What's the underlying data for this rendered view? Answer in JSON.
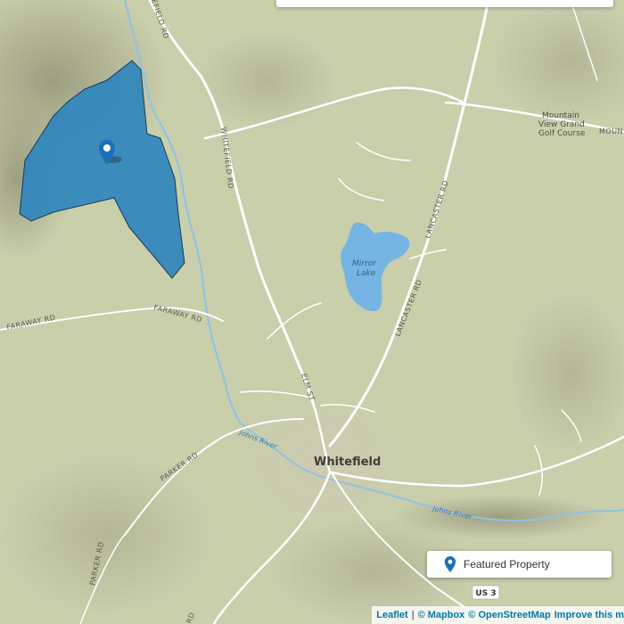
{
  "map": {
    "places": {
      "town": "Whitefield",
      "lake": [
        "Mirror",
        "Lake"
      ],
      "golf": [
        "Mountain",
        "View Grand",
        "Golf Course"
      ],
      "golf_road_fragment": "MOUN"
    },
    "roads": {
      "whitefield_rd_top": "EFIELD RD",
      "whitefield_rd": "WHITEFIELD RD",
      "lancaster_rd_upper": "LANCASTER RD",
      "lancaster_rd_lower": "LANCASTER RD",
      "elm_st": "ELM ST",
      "faraway_rd_left": "FARAWAY RD",
      "faraway_rd_right": "FARAWAY RD",
      "parker_rd_upper": "PARKER RD",
      "parker_rd_lower": "PARKER RD",
      "us3_shield": "US 3",
      "bottom_rd_fragment": "RD"
    },
    "rivers": {
      "johns_left": "Johns River",
      "johns_right": "Johns River"
    },
    "colors": {
      "land": "#c9ceab",
      "road": "#ffffff",
      "water": "#76b5e3",
      "river": "#8fc2e6",
      "parcel_fill": "#2f86bd",
      "parcel_stroke": "#163c56",
      "marker": "#1f6fb8"
    },
    "icons": {
      "property_marker": "map-marker-icon",
      "legend_marker": "map-marker-icon"
    }
  },
  "legend": {
    "label": "Featured Property"
  },
  "attribution": {
    "leaflet": "Leaflet",
    "separator": "|",
    "mapbox": "© Mapbox",
    "osm": "© OpenStreetMap",
    "improve": "Improve this m"
  }
}
